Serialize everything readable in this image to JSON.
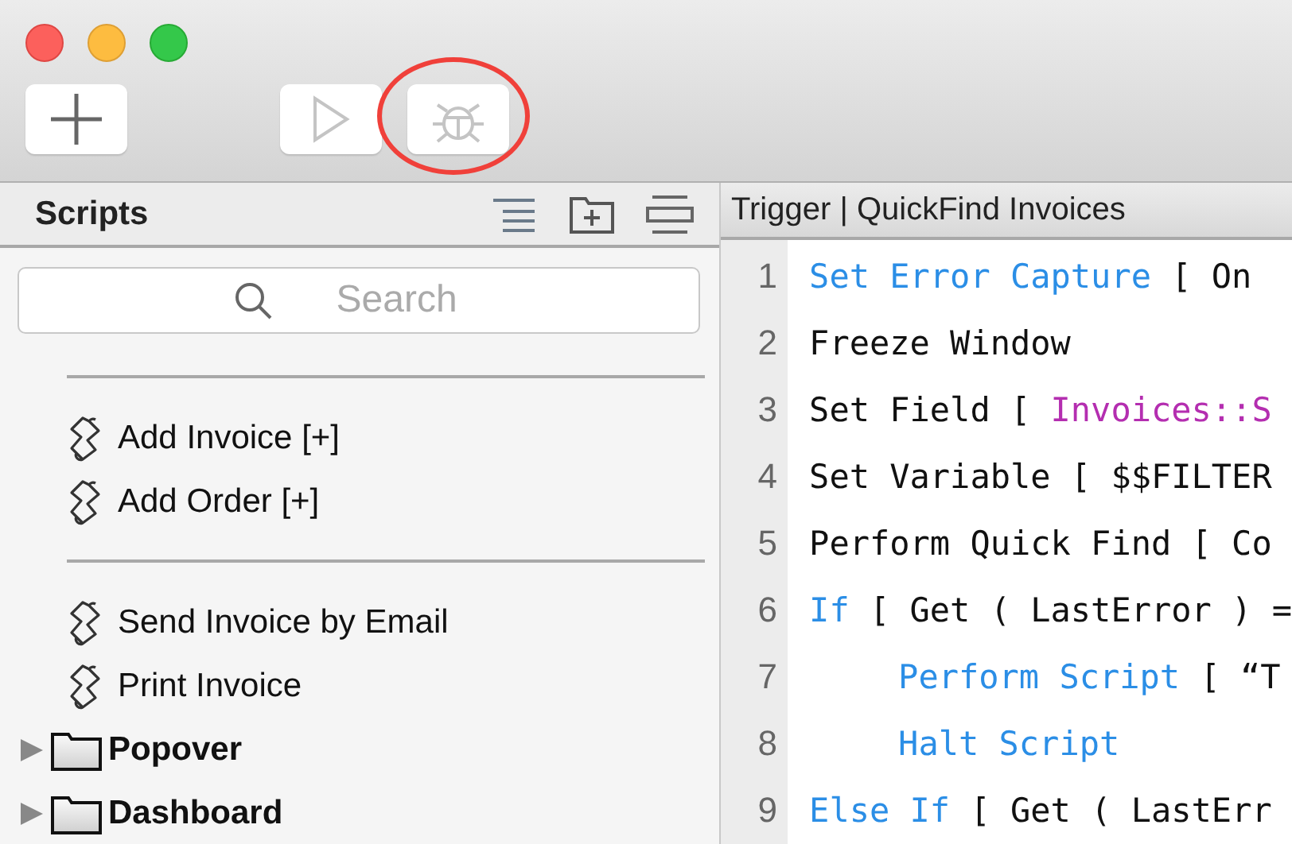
{
  "toolbar": {
    "buttons": [
      {
        "kind": "add",
        "disabled": false
      },
      {
        "kind": "run",
        "disabled": true
      },
      {
        "kind": "debug",
        "disabled": true,
        "highlighted": true
      }
    ]
  },
  "sidebar": {
    "title": "Scripts",
    "search": {
      "placeholder": "Search"
    },
    "items": [
      {
        "kind": "separator"
      },
      {
        "kind": "script",
        "label": "Add Invoice [+]"
      },
      {
        "kind": "script",
        "label": "Add Order [+]"
      },
      {
        "kind": "separator"
      },
      {
        "kind": "script",
        "label": "Send Invoice by Email"
      },
      {
        "kind": "script",
        "label": "Print Invoice"
      },
      {
        "kind": "folder",
        "label": "Popover",
        "expanded": false
      },
      {
        "kind": "folder",
        "label": "Dashboard",
        "expanded": false
      }
    ]
  },
  "editor": {
    "title": "Trigger | QuickFind Invoices",
    "lines": [
      {
        "number": "1",
        "tokens": [
          {
            "kind": "step",
            "text": "Set Error Capture"
          },
          {
            "kind": "plain",
            "text": " [ On"
          }
        ]
      },
      {
        "number": "2",
        "tokens": [
          {
            "kind": "plain",
            "text": "Freeze Window"
          }
        ]
      },
      {
        "number": "3",
        "tokens": [
          {
            "kind": "plain",
            "text": "Set Field [ "
          },
          {
            "kind": "field",
            "text": "Invoices::S"
          }
        ]
      },
      {
        "number": "4",
        "tokens": [
          {
            "kind": "plain",
            "text": "Set Variable [ $$FILTER"
          }
        ]
      },
      {
        "number": "5",
        "tokens": [
          {
            "kind": "plain",
            "text": "Perform Quick Find [ Co"
          }
        ]
      },
      {
        "number": "6",
        "tokens": [
          {
            "kind": "step",
            "text": "If"
          },
          {
            "kind": "plain",
            "text": " [ Get ( LastError ) ="
          }
        ],
        "children": [
          {
            "number": "7",
            "tokens": [
              {
                "kind": "step",
                "text": "Perform Script"
              },
              {
                "kind": "plain",
                "text": " [ “T"
              }
            ]
          },
          {
            "number": "8",
            "tokens": [
              {
                "kind": "step",
                "text": "Halt Script"
              }
            ]
          }
        ]
      },
      {
        "number": "9",
        "tokens": [
          {
            "kind": "step",
            "text": "Else If"
          },
          {
            "kind": "plain",
            "text": " [ Get ( LastErr"
          }
        ]
      }
    ]
  }
}
